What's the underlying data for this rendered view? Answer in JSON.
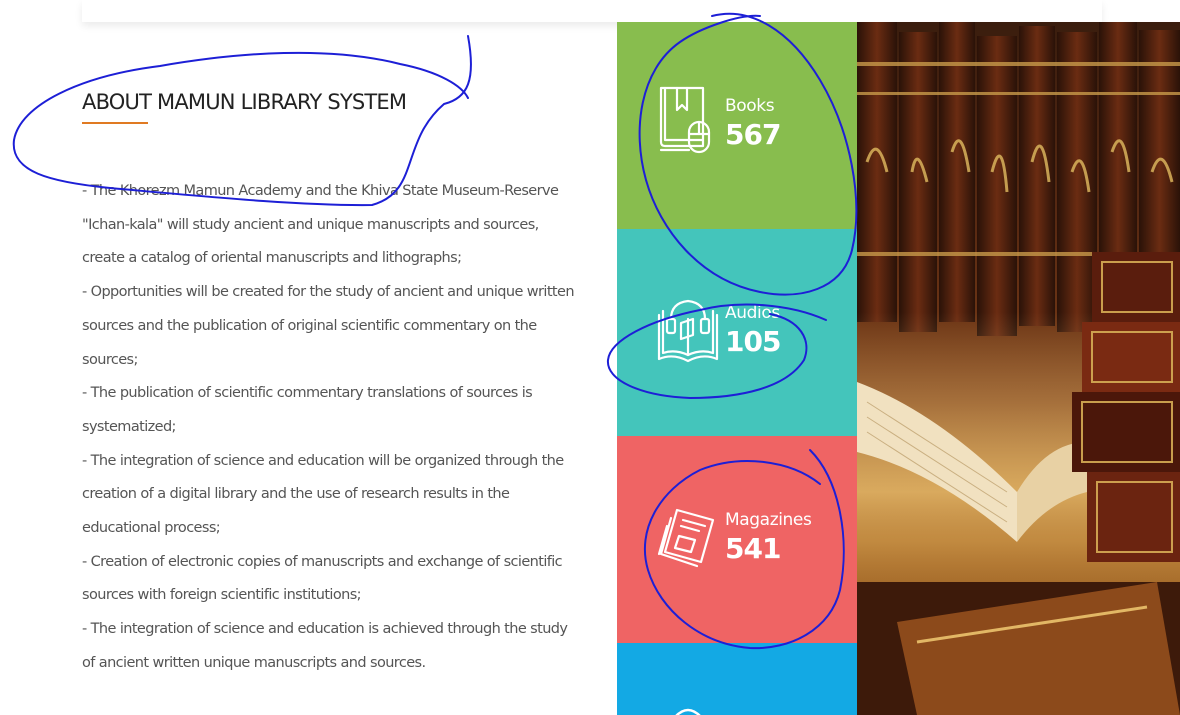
{
  "about": {
    "title": "ABOUT MAMUN LIBRARY SYSTEM",
    "lines": [
      "- The Khorezm Mamun Academy and the Khiva State Museum-Reserve",
      "\"Ichan-kala\" will study ancient and unique manuscripts and sources,",
      "create a catalog of oriental manuscripts and lithographs;",
      "- Opportunities will be created for the study of ancient and unique written",
      "sources and the publication of original scientific commentary on the",
      "sources;",
      "- The publication of scientific commentary translations of sources is",
      "systematized;",
      "- The integration of science and education will be organized through the",
      "creation of a digital library and the use of research results in the",
      "educational process;",
      "- Creation of electronic copies of manuscripts and exchange of scientific",
      "sources with foreign scientific institutions;",
      "- The integration of science and education is achieved through the study",
      "of ancient written unique manuscripts and sources."
    ]
  },
  "stats": [
    {
      "label": "Books",
      "count": "567",
      "icon": "book-icon",
      "color": "#88bd4e"
    },
    {
      "label": "Audios",
      "count": "105",
      "icon": "audio-book-icon",
      "color": "#44c5bb"
    },
    {
      "label": "Magazines",
      "count": "541",
      "icon": "magazine-icon",
      "color": "#ef6464"
    }
  ],
  "extra_tile": {
    "icon": "partial-icon",
    "color": "#13a9e4"
  },
  "colors": {
    "accent_underline": "#e07a22",
    "annotation_ink": "#1d1fd6"
  }
}
